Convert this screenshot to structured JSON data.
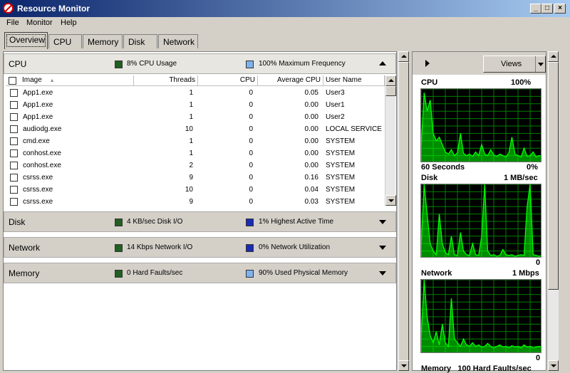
{
  "window": {
    "title": "Resource Monitor"
  },
  "menu": [
    "File",
    "Monitor",
    "Help"
  ],
  "tabs": [
    "Overview",
    "CPU",
    "Memory",
    "Disk",
    "Network"
  ],
  "cpu_section": {
    "title": "CPU",
    "stat1": "8% CPU Usage",
    "stat2": "100% Maximum Frequency",
    "columns": [
      "Image",
      "Threads",
      "CPU",
      "Average CPU",
      "User Name"
    ],
    "rows": [
      {
        "image": "App1.exe",
        "threads": "1",
        "cpu": "0",
        "avg": "0.05",
        "user": "User3"
      },
      {
        "image": "App1.exe",
        "threads": "1",
        "cpu": "0",
        "avg": "0.00",
        "user": "User1"
      },
      {
        "image": "App1.exe",
        "threads": "1",
        "cpu": "0",
        "avg": "0.00",
        "user": "User2"
      },
      {
        "image": "audiodg.exe",
        "threads": "10",
        "cpu": "0",
        "avg": "0.00",
        "user": "LOCAL SERVICE"
      },
      {
        "image": "cmd.exe",
        "threads": "1",
        "cpu": "0",
        "avg": "0.00",
        "user": "SYSTEM"
      },
      {
        "image": "conhost.exe",
        "threads": "1",
        "cpu": "0",
        "avg": "0.00",
        "user": "SYSTEM"
      },
      {
        "image": "conhost.exe",
        "threads": "2",
        "cpu": "0",
        "avg": "0.00",
        "user": "SYSTEM"
      },
      {
        "image": "csrss.exe",
        "threads": "9",
        "cpu": "0",
        "avg": "0.16",
        "user": "SYSTEM"
      },
      {
        "image": "csrss.exe",
        "threads": "10",
        "cpu": "0",
        "avg": "0.04",
        "user": "SYSTEM"
      },
      {
        "image": "csrss.exe",
        "threads": "9",
        "cpu": "0",
        "avg": "0.03",
        "user": "SYSTEM"
      }
    ]
  },
  "disk_section": {
    "title": "Disk",
    "stat1": "4 KB/sec Disk I/O",
    "stat2": "1% Highest Active Time"
  },
  "network_section": {
    "title": "Network",
    "stat1": "14 Kbps Network I/O",
    "stat2": "0% Network Utilization"
  },
  "memory_section": {
    "title": "Memory",
    "stat1": "0 Hard Faults/sec",
    "stat2": "90% Used Physical Memory"
  },
  "right_panel": {
    "views_label": "Views",
    "cpu_graph": {
      "label": "CPU",
      "max": "100%",
      "footer_left": "60 Seconds",
      "footer_right": "0%"
    },
    "disk_graph": {
      "label": "Disk",
      "max": "1 MB/sec",
      "footer_right": "0"
    },
    "network_graph": {
      "label": "Network",
      "max": "1 Mbps",
      "footer_right": "0"
    },
    "memory_graph": {
      "label": "Memory",
      "max": "100 Hard Faults/sec"
    }
  },
  "colors": {
    "green_series": "#00ff00",
    "blue_series": "#3060ff",
    "grid": "#008000"
  }
}
